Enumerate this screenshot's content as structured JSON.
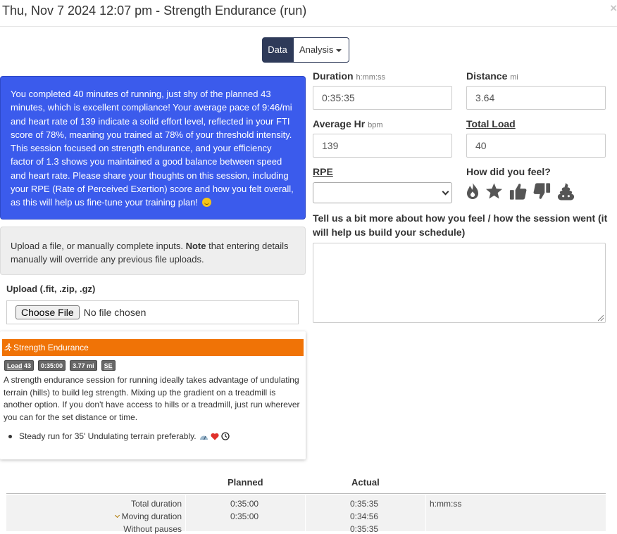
{
  "header": {
    "title": "Thu, Nov 7 2024 12:07 pm - Strength Endurance (run)",
    "close_icon": "×"
  },
  "view_toggle": {
    "data_label": "Data",
    "analysis_label": "Analysis",
    "active": "Data"
  },
  "ai_summary": {
    "text": "You completed 40 minutes of running, just shy of the planned 43 minutes, which is excellent compliance! Your average pace of 9:46/mi and heart rate of 139 indicate a solid effort level, reflected in your FTI score of 78%, meaning you trained at 78% of your threshold intensity. This session focused on strength endurance, and your efficiency factor of 1.3 shows you maintained a good balance between speed and heart rate. Please share your thoughts on this session, including your RPE (Rate of Perceived Exertion) score and how you felt overall, as this will help us fine-tune your training plan!",
    "emoji": "smile-emoji",
    "color": "#3b5bec"
  },
  "upload": {
    "note_prefix": "Upload a file, or manually complete inputs. ",
    "note_bold": "Note",
    "note_suffix": " that entering details manually will override any previous file uploads.",
    "label": "Upload (.fit, .zip, .gz)",
    "button_label": "Choose File",
    "status": "No file chosen"
  },
  "workout": {
    "title": "Strength Endurance",
    "header_color": "#f07306",
    "icon": "runner-icon",
    "badges": [
      {
        "label": "Load",
        "value": "43"
      },
      {
        "label": "",
        "value": "0:35:00"
      },
      {
        "label": "",
        "value": "3.77 mi"
      },
      {
        "label": "",
        "value": "SE"
      }
    ],
    "description": "A strength endurance session for running ideally takes advantage of undulating terrain (hills) to build leg strength. Mixing up the gradient on a treadmill is another option. If you don't have access to hills or a treadmill, just run wherever you can for the set distance or time.",
    "step": "Steady run for 35' Undulating terrain preferably.",
    "step_icons": [
      "gauge-icon",
      "heart-icon",
      "clock-icon"
    ]
  },
  "fields": {
    "duration": {
      "label": "Duration",
      "unit": "h:mm:ss",
      "value": "0:35:35"
    },
    "distance": {
      "label": "Distance",
      "unit": "mi",
      "value": "3.64"
    },
    "avg_hr": {
      "label": "Average Hr",
      "unit": "bpm",
      "value": "139"
    },
    "total_load": {
      "label": "Total Load",
      "value": "40"
    },
    "rpe": {
      "label": "RPE",
      "value": ""
    },
    "feel": {
      "label": "How did you feel?",
      "icons": [
        "fire-icon",
        "star-icon",
        "thumbs-up-icon",
        "thumbs-down-icon",
        "poop-icon"
      ]
    },
    "notes": {
      "label": "Tell us a bit more about how you feel / how the session went (it will help us build your schedule)",
      "value": ""
    }
  },
  "comparison_table": {
    "headers": {
      "planned": "Planned",
      "actual": "Actual"
    },
    "rows": [
      {
        "label": "Total duration",
        "planned": "0:35:00",
        "actual": "0:35:35",
        "unit": "h:mm:ss",
        "expandable": false
      },
      {
        "label": "Moving duration",
        "planned": "0:35:00",
        "actual": "0:34:56",
        "unit": "",
        "expandable": true
      },
      {
        "label": "Without pauses",
        "planned": "",
        "actual": "0:35:35",
        "unit": "",
        "expandable": false
      }
    ]
  }
}
